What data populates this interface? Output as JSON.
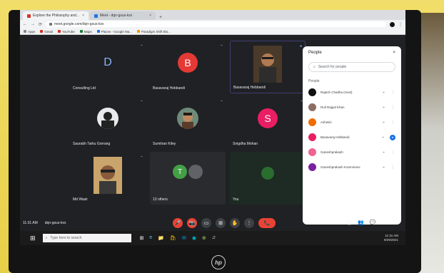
{
  "browser": {
    "tabs": [
      {
        "label": "Explore the Philosophy and...",
        "active": true
      },
      {
        "label": "Meet - dqn-gsus-kxx",
        "active": false
      }
    ],
    "new_tab": "+",
    "address": "meet.google.com/dqn-gsus-kxx",
    "nav": {
      "back": "←",
      "forward": "→",
      "reload": "⟳"
    },
    "bookmarks": [
      {
        "label": "Apps",
        "icon": "apps-icon",
        "color": "#888888"
      },
      {
        "label": "Gmail",
        "icon": "gmail-icon",
        "color": "#d93025"
      },
      {
        "label": "YouTube",
        "icon": "youtube-icon",
        "color": "#d93025"
      },
      {
        "label": "Maps",
        "icon": "maps-icon",
        "color": "#188038"
      },
      {
        "label": "Places - Google Ma...",
        "icon": "places-icon",
        "color": "#1a73e8"
      },
      {
        "label": "Paradigm Shift Blo...",
        "icon": "blog-icon",
        "color": "#f29900"
      }
    ]
  },
  "tiles": [
    {
      "kind": "letter",
      "letter": "D",
      "name": "Consulting Ltd",
      "mic": "🎤"
    },
    {
      "kind": "letter",
      "letter": "B",
      "name": "Basavaraj Hebbandi",
      "mic": "🎤"
    },
    {
      "kind": "video",
      "name": "Basavaraj Hebbandi",
      "mic": "🎤"
    },
    {
      "kind": "photo",
      "name": "Saurabh Tarku Gorrang",
      "mic": "🎤"
    },
    {
      "kind": "photo",
      "name": "Sumitran Kiley",
      "mic": "🎤"
    },
    {
      "kind": "letter",
      "letter": "S",
      "name": "Snigdha Mohan",
      "mic": "🎤"
    },
    {
      "kind": "video",
      "name": "Md Wasir",
      "mic": "🎤"
    },
    {
      "kind": "pair",
      "letter": "T",
      "name": "13 others",
      "mic": ""
    },
    {
      "kind": "self",
      "name": "You",
      "mic": ""
    }
  ],
  "panel": {
    "title": "People",
    "close": "×",
    "search_placeholder": "Search for people",
    "section_label": "People",
    "people": [
      {
        "name": "Rajesh Chadha (Host)",
        "color": "#111111",
        "icon2": "⋮"
      },
      {
        "name": "Ruli Rajpal Khan",
        "color": "#8d6e63",
        "icon2": "⋮"
      },
      {
        "name": "Ashwini",
        "color": "#ef6c00",
        "icon2": "⋮"
      },
      {
        "name": "Basavaraj Hebbandi",
        "color": "#e91e63",
        "icon2": "●"
      },
      {
        "name": "Ganeshprakash",
        "color": "#f06292",
        "icon2": "⋮"
      },
      {
        "name": "Ganeshprakash Kommineni",
        "color": "#7b1fa2",
        "icon2": "⋮"
      }
    ]
  },
  "meeting": {
    "time": "11:31 AM",
    "code": "dqn-gsus-kxx"
  },
  "controls": [
    "🎤",
    "📷",
    "▭",
    "⊞",
    "✋",
    "⋮",
    "📞"
  ],
  "right_controls": [
    "ⓘ",
    "👥",
    "💬",
    "⬚"
  ],
  "taskbar": {
    "search_placeholder": "Type here to search",
    "apps": [
      "⊞",
      "e",
      "📁",
      "🛍",
      "✉",
      "◉",
      "⊕",
      "♫"
    ],
    "time": "11:31 AM",
    "date": "8/29/2021"
  },
  "brand": "hp"
}
